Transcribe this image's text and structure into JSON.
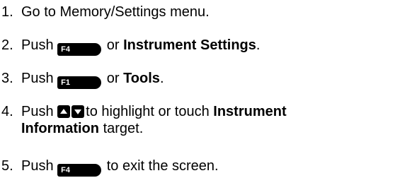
{
  "steps": [
    {
      "number": "1.",
      "text": "Go to Memory/Settings menu."
    },
    {
      "number": "2.",
      "push": "Push",
      "key": "F4",
      "or": "or",
      "target": "Instrument Settings",
      "end": "."
    },
    {
      "number": "3.",
      "push": "Push",
      "key": "F1",
      "or": "or",
      "target": "Tools",
      "end": "."
    },
    {
      "number": "4.",
      "push": "Push",
      "mid": "to highlight or touch",
      "target_line1": "Instrument",
      "target_line2": "Information",
      "end": "target."
    },
    {
      "number": "5.",
      "push": "Push",
      "key": "F4",
      "end": "to exit the screen."
    }
  ],
  "icons": {
    "function_key": "function-key-icon",
    "up_arrow": "up-arrow-key-icon",
    "down_arrow": "down-arrow-key-icon"
  }
}
